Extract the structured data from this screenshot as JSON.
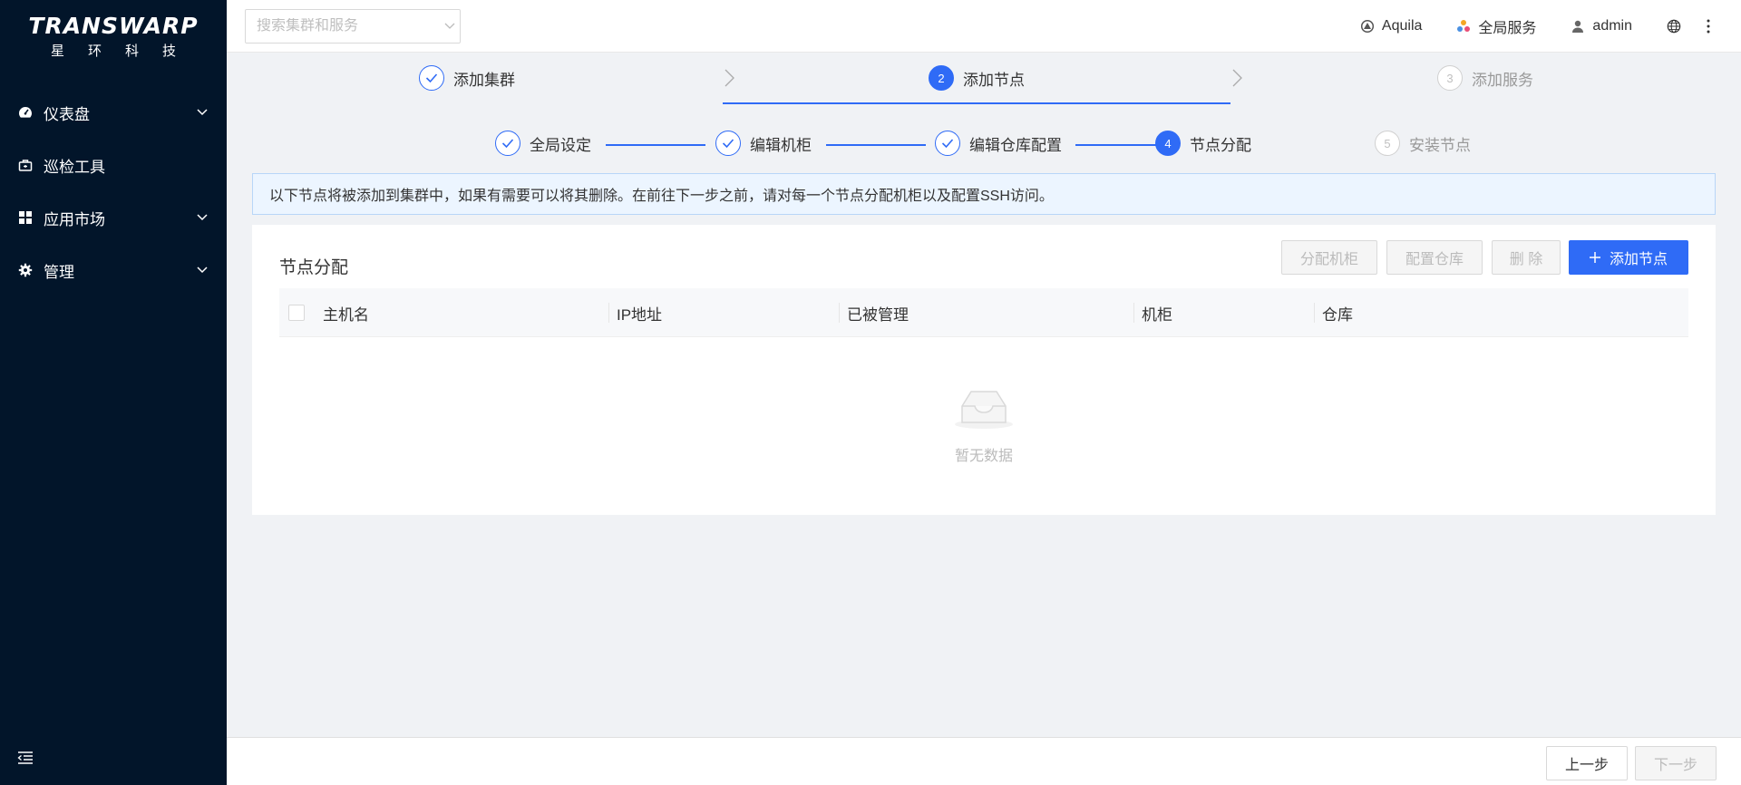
{
  "sidebar": {
    "logo_main": "TRANSWARP",
    "logo_sub": "星环科技",
    "items": [
      {
        "label": "仪表盘",
        "icon": "dashboard-icon",
        "has_arrow": true
      },
      {
        "label": "巡检工具",
        "icon": "toolbox-icon",
        "has_arrow": false
      },
      {
        "label": "应用市场",
        "icon": "grid-icon",
        "has_arrow": true
      },
      {
        "label": "管理",
        "icon": "gear-icon",
        "has_arrow": true
      }
    ]
  },
  "header": {
    "search_placeholder": "搜索集群和服务",
    "cluster": "Aquila",
    "global_services": "全局服务",
    "user": "admin"
  },
  "main_steps": [
    {
      "label": "添加集群",
      "state": "done",
      "number": ""
    },
    {
      "label": "添加节点",
      "state": "active",
      "number": "2"
    },
    {
      "label": "添加服务",
      "state": "wait",
      "number": "3"
    }
  ],
  "sub_steps": [
    {
      "label": "全局设定",
      "state": "done",
      "number": ""
    },
    {
      "label": "编辑机柜",
      "state": "done",
      "number": ""
    },
    {
      "label": "编辑仓库配置",
      "state": "done",
      "number": ""
    },
    {
      "label": "节点分配",
      "state": "active",
      "number": "4"
    },
    {
      "label": "安装节点",
      "state": "wait",
      "number": "5"
    }
  ],
  "alert": "以下节点将被添加到集群中，如果有需要可以将其删除。在前往下一步之前，请对每一个节点分配机柜以及配置SSH访问。",
  "card": {
    "title": "节点分配",
    "btn_assign_rack": "分配机柜",
    "btn_config_repo": "配置仓库",
    "btn_delete": "删 除",
    "btn_add_node": "添加节点",
    "columns": [
      "主机名",
      "IP地址",
      "已被管理",
      "机柜",
      "仓库"
    ],
    "empty_text": "暂无数据"
  },
  "footer": {
    "prev": "上一步",
    "next": "下一步"
  },
  "colors": {
    "primary": "#2f6bf6",
    "sidebar_bg": "#02152a"
  }
}
